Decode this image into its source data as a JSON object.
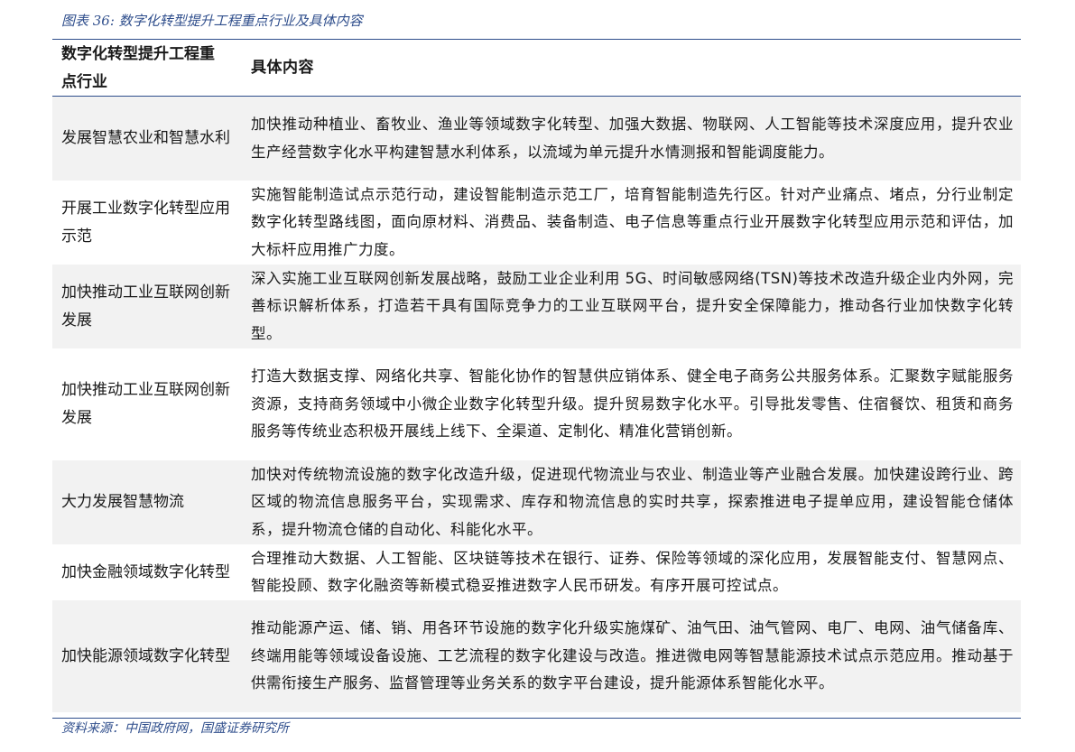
{
  "caption": "图表 36:  数字化转型提升工程重点行业及具体内容",
  "table": {
    "headers": [
      "数字化转型提升工程重点行业",
      "具体内容"
    ],
    "rows": [
      {
        "industry": "发展智慧农业和智慧水利",
        "content": "加快推动种植业、畜牧业、渔业等领域数字化转型、加强大数据、物联网、人工智能等技术深度应用，提升农业生产经营数字化水平构建智慧水利体系，以流域为单元提升水情测报和智能调度能力。"
      },
      {
        "industry": "开展工业数字化转型应用示范",
        "content": "实施智能制造试点示范行动，建设智能制造示范工厂，培育智能制造先行区。针对产业痛点、堵点，分行业制定数字化转型路线图，面向原材料、消费品、装备制造、电子信息等重点行业开展数字化转型应用示范和评估，加大标杆应用推广力度。"
      },
      {
        "industry": "加快推动工业互联网创新发展",
        "content": "深入实施工业互联网创新发展战略，鼓励工业企业利用 5G、时间敏感网络(TSN)等技术改造升级企业内外网，完善标识解析体系，打造若干具有国际竞争力的工业互联网平台，提升安全保障能力，推动各行业加快数字化转型。"
      },
      {
        "industry": "加快推动工业互联网创新发展",
        "content": "打造大数据支撑、网络化共享、智能化协作的智慧供应销体系、健全电子商务公共服务体系。汇聚数字赋能服务资源，支持商务领域中小微企业数字化转型升级。提升贸易数字化水平。引导批发零售、住宿餐饮、租赁和商务服务等传统业态积极开展线上线下、全渠道、定制化、精准化营销创新。"
      },
      {
        "industry": "大力发展智慧物流",
        "content": "加快对传统物流设施的数字化改造升级，促进现代物流业与农业、制造业等产业融合发展。加快建设跨行业、跨区域的物流信息服务平台，实现需求、库存和物流信息的实时共享，探索推进电子提单应用，建设智能仓储体系，提升物流仓储的自动化、科能化水平。"
      },
      {
        "industry": "加快金融领域数字化转型",
        "content": "合理推动大数据、人工智能、区块链等技术在银行、证券、保险等领域的深化应用，发展智能支付、智慧网点、智能投顾、数字化融资等新模式稳妥推进数字人民币研发。有序开展可控试点。"
      },
      {
        "industry": "加快能源领域数字化转型",
        "content": "推动能源产运、储、销、用各环节设施的数字化升级实施煤矿、油气田、油气管网、电厂、电网、油气储备库、终端用能等领域设备设施、工艺流程的数字化建设与改造。推进微电网等智慧能源技术试点示范应用。推动基于供需衔接生产服务、监督管理等业务关系的数字平台建设，提升能源体系智能化水平。"
      }
    ]
  },
  "source": "资料来源：中国政府网，国盛证券研究所"
}
